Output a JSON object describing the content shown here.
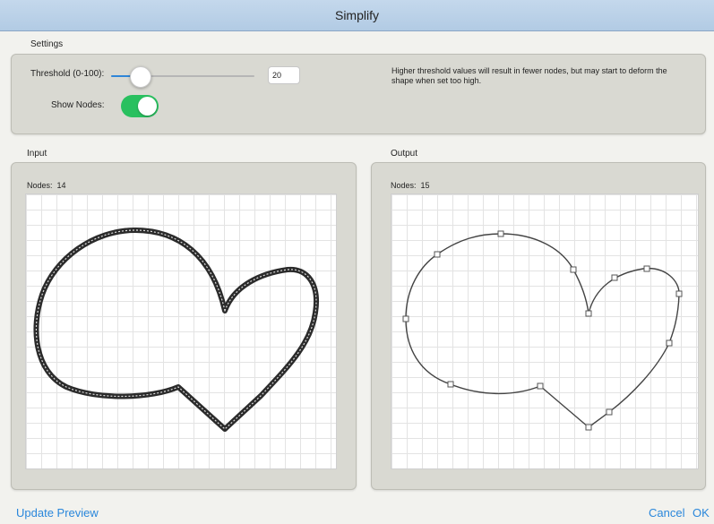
{
  "window": {
    "title": "Simplify"
  },
  "settings": {
    "section_label": "Settings",
    "threshold_label": "Threshold (0-100):",
    "threshold_value": "20",
    "threshold_fraction": 0.2,
    "help_text": "Higher threshold values will result in fewer nodes, but may start to deform the shape when set too high.",
    "show_nodes_label": "Show Nodes:",
    "show_nodes_on": true,
    "accent_color": "#2f86d8",
    "toggle_color": "#29c05f"
  },
  "input": {
    "section_label": "Input",
    "nodes_label": "Nodes:",
    "nodes_count": "14"
  },
  "output": {
    "section_label": "Output",
    "nodes_label": "Nodes:",
    "nodes_count": "15"
  },
  "footer": {
    "update_preview_label": "Update Preview",
    "cancel_label": "Cancel",
    "ok_label": "OK",
    "link_color": "#2a87db"
  }
}
